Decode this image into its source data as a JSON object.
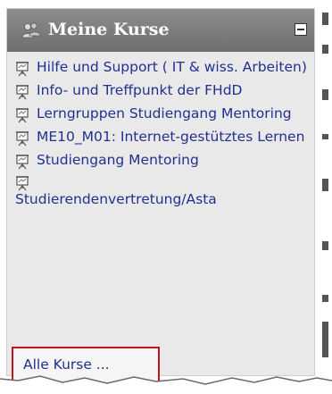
{
  "block": {
    "title": "Meine Kurse",
    "title_icon": "users-icon",
    "collapse_icon": "minus-box-icon"
  },
  "courses": [
    {
      "label": "Hilfe und Support ( IT & wiss. Arbeiten)",
      "icon": "easel-icon"
    },
    {
      "label": "Info- und Treffpunkt der FHdD",
      "icon": "easel-icon"
    },
    {
      "label": "Lerngruppen Studiengang Mentoring",
      "icon": "easel-icon"
    },
    {
      "label": "ME10_M01: Internet-gestütztes Lernen",
      "icon": "easel-icon"
    },
    {
      "label": "Studiengang Mentoring",
      "icon": "easel-icon"
    },
    {
      "label": "Studierendenvertretung/Asta",
      "icon": "easel-icon"
    }
  ],
  "all_courses": {
    "label": "Alle Kurse ..."
  },
  "colors": {
    "header_bg": "#7a7a7a",
    "block_bg": "#e9e9e9",
    "link": "#22308f",
    "highlight": "#c0171c"
  }
}
